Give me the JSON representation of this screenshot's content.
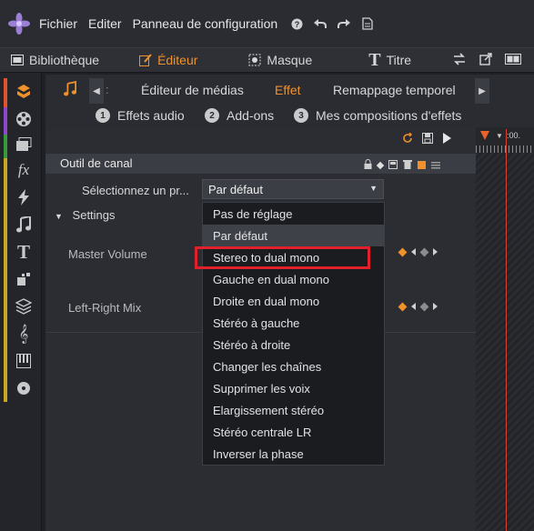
{
  "menubar": {
    "items": [
      "Fichier",
      "Editer",
      "Panneau de configuration"
    ],
    "icons": [
      "help-icon",
      "undo-icon",
      "redo-icon",
      "document-icon"
    ]
  },
  "main_tabs": [
    {
      "label": "Bibliothèque",
      "icon": "library-icon"
    },
    {
      "label": "Éditeur",
      "icon": "edit-icon",
      "active": true
    },
    {
      "label": "Masque",
      "icon": "mask-icon"
    },
    {
      "label": "Titre",
      "icon": "title-icon"
    }
  ],
  "sub_tabs": [
    {
      "label": "Éditeur de médias"
    },
    {
      "label": "Effet",
      "active": true
    },
    {
      "label": "Remappage temporel"
    }
  ],
  "categories": [
    {
      "num": "1",
      "label": "Effets audio"
    },
    {
      "num": "2",
      "label": "Add-ons"
    },
    {
      "num": "3",
      "label": "Mes compositions d'effets"
    }
  ],
  "tool": {
    "title": "Outil de canal",
    "preset_label": "Sélectionnez un pr...",
    "preset_value": "Par défaut",
    "settings_label": "Settings",
    "params": [
      "Master Volume",
      "Left-Right Mix"
    ]
  },
  "timeline": {
    "timecode": ":00."
  },
  "dropdown": {
    "options": [
      "Pas de réglage",
      "Par défaut",
      "Stereo to dual mono",
      "Gauche en dual mono",
      "Droite en dual mono",
      "Stéréo à gauche",
      "Stéréo à droite",
      "Changer les chaînes",
      "Supprimer les voix",
      "Elargissement stéréo",
      "Stéréo centrale LR",
      "Inverser la phase"
    ],
    "selected": "Par défaut",
    "highlighted": "Stereo to dual mono"
  },
  "colors": {
    "accent": "#f0922c",
    "highlight_box": "#e0202a",
    "playhead": "#d8412f"
  }
}
